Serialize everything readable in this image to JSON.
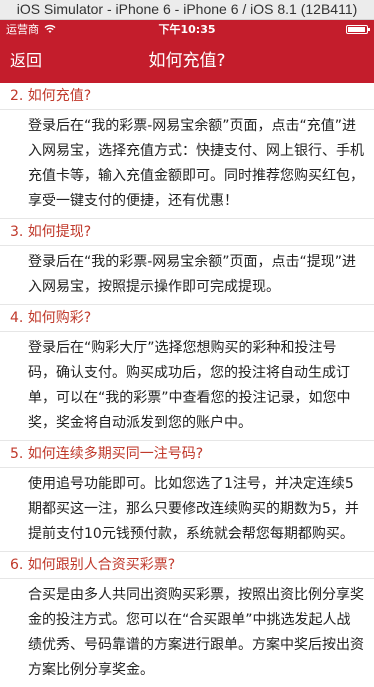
{
  "simulator": {
    "title": "iOS Simulator - iPhone 6 - iPhone 6 / iOS 8.1 (12B411)"
  },
  "statusbar": {
    "carrier": "运营商",
    "time": "下午10:35",
    "battery_level": 0.95
  },
  "navbar": {
    "back_label": "返回",
    "title": "如何充值?"
  },
  "faq": [
    {
      "question": "2. 如何充值?",
      "answer": "登录后在“我的彩票-网易宝余额”页面，点击“充值”进入网易宝，选择充值方式：快捷支付、网上银行、手机充值卡等，输入充值金额即可。同时推荐您购买红包，享受一键支付的便捷，还有优惠！"
    },
    {
      "question": "3. 如何提现?",
      "answer": "登录后在“我的彩票-网易宝余额”页面，点击“提现”进入网易宝，按照提示操作即可完成提现。"
    },
    {
      "question": "4. 如何购彩?",
      "answer": "登录后在“购彩大厅”选择您想购买的彩种和投注号码，确认支付。购买成功后，您的投注将自动生成订单，可以在“我的彩票”中查看您的投注记录，如您中奖，奖金将自动派发到您的账户中。"
    },
    {
      "question": "5. 如何连续多期买同一注号码?",
      "answer": "使用追号功能即可。比如您选了1注号，并决定连续5期都买这一注，那么只要修改连续购买的期数为5，并提前支付10元钱预付款，系统就会帮您每期都购买。"
    },
    {
      "question": "6. 如何跟别人合资买彩票?",
      "answer": "合买是由多人共同出资购买彩票，按照出资比例分享奖金的投注方式。您可以在“合买跟单”中挑选发起人战绩优秀、号码靠谱的方案进行跟单。方案中奖后按出资方案比例分享奖金。"
    }
  ]
}
